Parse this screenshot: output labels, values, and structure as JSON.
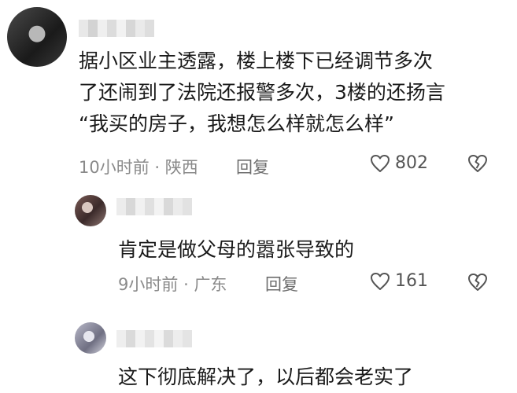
{
  "comments": [
    {
      "text_lines": [
        "据小区业主透露，楼上楼下已经调节多次",
        "了还闹到了法院还报警多次，3楼的还扬言",
        "“我买的房子，我想怎么样就怎么样”"
      ],
      "time": "10小时前",
      "location": "陕西",
      "reply_label": "回复",
      "likes": "802",
      "icons": {
        "like": "heart-icon",
        "dislike": "broken-heart-icon"
      }
    },
    {
      "text": "肯定是做父母的嚣张导致的",
      "time": "9小时前",
      "location": "广东",
      "reply_label": "回复",
      "likes": "161",
      "icons": {
        "like": "heart-icon",
        "dislike": "broken-heart-icon"
      }
    },
    {
      "text": "这下彻底解决了，以后都会老实了"
    }
  ],
  "separator": "·",
  "colors": {
    "text": "#1a1a1a",
    "meta": "#8a8a8a",
    "reply": "#6e6e6e"
  }
}
